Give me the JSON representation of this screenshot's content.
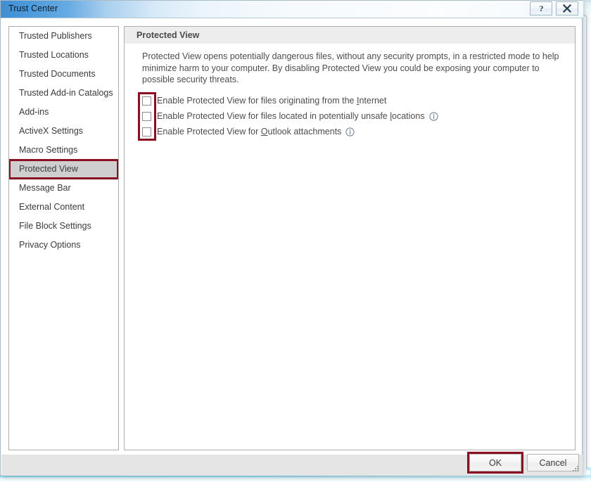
{
  "window": {
    "title": "Trust Center",
    "help_button": "?",
    "close_button": "X"
  },
  "sidebar": {
    "items": [
      {
        "label": "Trusted Publishers",
        "selected": false
      },
      {
        "label": "Trusted Locations",
        "selected": false
      },
      {
        "label": "Trusted Documents",
        "selected": false
      },
      {
        "label": "Trusted Add-in Catalogs",
        "selected": false
      },
      {
        "label": "Add-ins",
        "selected": false
      },
      {
        "label": "ActiveX Settings",
        "selected": false
      },
      {
        "label": "Macro Settings",
        "selected": false
      },
      {
        "label": "Protected View",
        "selected": true
      },
      {
        "label": "Message Bar",
        "selected": false
      },
      {
        "label": "External Content",
        "selected": false
      },
      {
        "label": "File Block Settings",
        "selected": false
      },
      {
        "label": "Privacy Options",
        "selected": false
      }
    ]
  },
  "content": {
    "header": "Protected View",
    "description": "Protected View opens potentially dangerous files, without any security prompts, in a restricted mode to help minimize harm to your computer. By disabling Protected View you could be exposing your computer to possible security threats.",
    "checkboxes": [
      {
        "label_before": "Enable Protected View for files originating from the ",
        "accelerator": "I",
        "label_after": "nternet",
        "checked": false,
        "has_info_icon": false
      },
      {
        "label_before": "Enable Protected View for files located in potentially unsafe ",
        "accelerator": "l",
        "label_after": "ocations",
        "checked": false,
        "has_info_icon": true
      },
      {
        "label_before": "Enable Protected View for ",
        "accelerator": "O",
        "label_after": "utlook attachments",
        "checked": false,
        "has_info_icon": true
      }
    ]
  },
  "footer": {
    "ok_label": "OK",
    "cancel_label": "Cancel"
  },
  "annotations": {
    "highlight_color": "#8b0f22",
    "targets": [
      "protected-view-sidebar-item",
      "protected-view-checkbox-group",
      "ok-button"
    ]
  }
}
